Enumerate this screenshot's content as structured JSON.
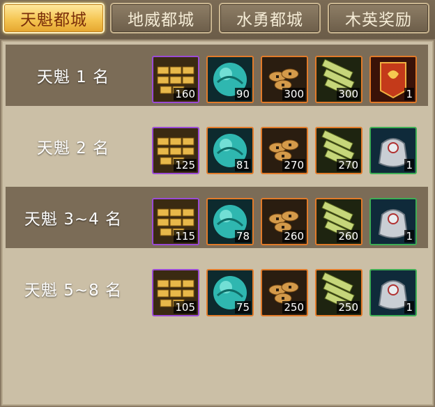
{
  "tabs": [
    {
      "label": "天魁都城",
      "active": true
    },
    {
      "label": "地威都城",
      "active": false
    },
    {
      "label": "水勇都城",
      "active": false
    },
    {
      "label": "木英奖励",
      "active": false
    }
  ],
  "rows": [
    {
      "rank": "天魁 1 名",
      "items": [
        {
          "icon": "gold-bars-icon",
          "count": "160"
        },
        {
          "icon": "jade-orb-icon",
          "count": "90"
        },
        {
          "icon": "coins-icon",
          "count": "300"
        },
        {
          "icon": "bamboo-icon",
          "count": "300"
        },
        {
          "icon": "red-banner-icon",
          "count": "1"
        }
      ]
    },
    {
      "rank": "天魁 2 名",
      "items": [
        {
          "icon": "gold-bars-icon",
          "count": "125"
        },
        {
          "icon": "jade-orb-icon",
          "count": "81"
        },
        {
          "icon": "coins-icon",
          "count": "270"
        },
        {
          "icon": "bamboo-icon",
          "count": "270"
        },
        {
          "icon": "silver-pouch-icon",
          "count": "1"
        }
      ]
    },
    {
      "rank": "天魁 3~4 名",
      "items": [
        {
          "icon": "gold-bars-icon",
          "count": "115"
        },
        {
          "icon": "jade-orb-icon",
          "count": "78"
        },
        {
          "icon": "coins-icon",
          "count": "260"
        },
        {
          "icon": "bamboo-icon",
          "count": "260"
        },
        {
          "icon": "silver-pouch-icon",
          "count": "1"
        }
      ]
    },
    {
      "rank": "天魁 5~8 名",
      "items": [
        {
          "icon": "gold-bars-icon",
          "count": "105"
        },
        {
          "icon": "jade-orb-icon",
          "count": "75"
        },
        {
          "icon": "coins-icon",
          "count": "250"
        },
        {
          "icon": "bamboo-icon",
          "count": "250"
        },
        {
          "icon": "silver-pouch-icon",
          "count": "1"
        }
      ]
    }
  ],
  "colors": {
    "active_tab": "#f5c653",
    "rarity_purple": "#9b4bd6",
    "rarity_orange": "#e27b2a",
    "rarity_green": "#3fae55"
  }
}
